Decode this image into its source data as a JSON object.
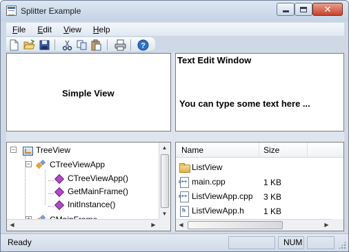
{
  "window": {
    "title": "Splitter Example"
  },
  "menubar": {
    "items": [
      {
        "label": "File",
        "mnemonic": "F",
        "rest": "ile"
      },
      {
        "label": "Edit",
        "mnemonic": "E",
        "rest": "dit"
      },
      {
        "label": "View",
        "mnemonic": "V",
        "rest": "iew"
      },
      {
        "label": "Help",
        "mnemonic": "H",
        "rest": "elp"
      }
    ]
  },
  "toolbar": {
    "buttons": [
      {
        "icon": "new-document-icon"
      },
      {
        "icon": "open-folder-icon"
      },
      {
        "icon": "save-floppy-icon"
      },
      {
        "icon": "cut-scissors-icon"
      },
      {
        "icon": "copy-icon"
      },
      {
        "icon": "paste-clipboard-icon"
      },
      {
        "icon": "print-icon"
      },
      {
        "icon": "help-about-icon"
      }
    ]
  },
  "simple_view": {
    "label": "Simple View"
  },
  "text_edit": {
    "title": "Text Edit Window",
    "body": "You can type some text here ..."
  },
  "tree": {
    "root": "TreeView",
    "class1": "CTreeViewApp",
    "methods": [
      "CTreeViewApp()",
      "GetMainFrame()",
      "InitInstance()"
    ],
    "class2": "CMainFrame"
  },
  "list": {
    "columns": [
      "Name",
      "Size"
    ],
    "rows": [
      {
        "name": "ListView",
        "size": "",
        "icon": "folder-icon"
      },
      {
        "name": "main.cpp",
        "size": "1 KB",
        "icon": "cpp-file-icon"
      },
      {
        "name": "ListViewApp.cpp",
        "size": "3 KB",
        "icon": "cpp-file-icon"
      },
      {
        "name": "ListViewApp.h",
        "size": "1 KB",
        "icon": "header-file-icon"
      }
    ]
  },
  "statusbar": {
    "text": "Ready",
    "num": "NUM"
  },
  "colors": {
    "frame": "#cfd9e6",
    "close_button": "#c8432c",
    "accent_blue": "#3a6fb7"
  }
}
